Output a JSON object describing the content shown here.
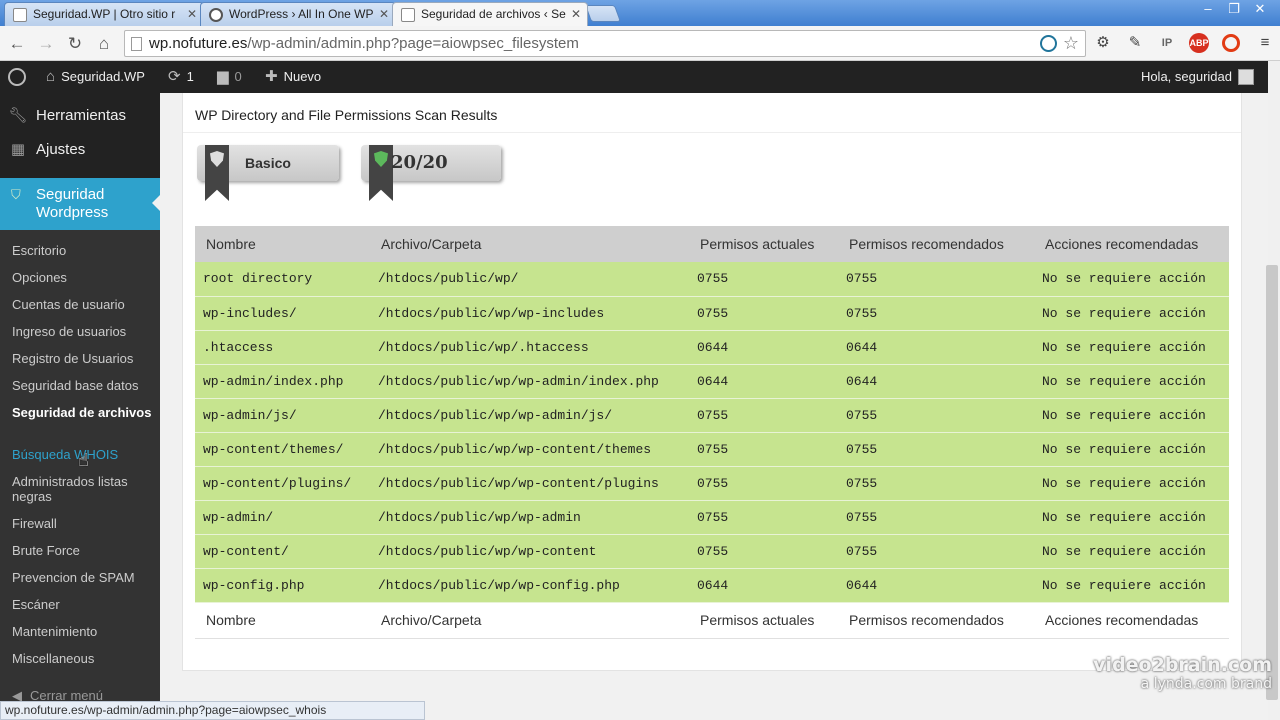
{
  "browser": {
    "tabs": [
      {
        "label": "Seguridad.WP | Otro sitio r",
        "active": false
      },
      {
        "label": "WordPress › All In One WP",
        "active": false
      },
      {
        "label": "Seguridad de archivos ‹ Se",
        "active": true
      }
    ],
    "url_host": "wp.nofuture.es",
    "url_path": "/wp-admin/admin.php?page=aiowpsec_filesystem",
    "status_url": "wp.nofuture.es/wp-admin/admin.php?page=aiowpsec_whois"
  },
  "adminbar": {
    "site_name": "Seguridad.WP",
    "updates_count": "1",
    "comments_count": "0",
    "new_label": "Nuevo",
    "greeting": "Hola, seguridad"
  },
  "sidebar": {
    "top_items": [
      {
        "label": "Herramientas",
        "icon": "wrench-icon"
      },
      {
        "label": "Ajustes",
        "icon": "settings-icon"
      }
    ],
    "active_menu": "Seguridad Wordpress",
    "submenu": [
      {
        "label": "Escritorio"
      },
      {
        "label": "Opciones"
      },
      {
        "label": "Cuentas de usuario"
      },
      {
        "label": "Ingreso de usuarios"
      },
      {
        "label": "Registro de Usuarios"
      },
      {
        "label": "Seguridad base datos"
      },
      {
        "label": "Seguridad de archivos",
        "current": true
      },
      {
        "label": "Búsqueda WHOIS",
        "hover": true
      },
      {
        "label": "Administrados listas negras"
      },
      {
        "label": "Firewall"
      },
      {
        "label": "Brute Force"
      },
      {
        "label": "Prevencion de SPAM"
      },
      {
        "label": "Escáner"
      },
      {
        "label": "Mantenimiento"
      },
      {
        "label": "Miscellaneous"
      }
    ],
    "collapse_label": "Cerrar menú"
  },
  "content": {
    "box_title": "WP Directory and File Permissions Scan Results",
    "badge_level": "Basico",
    "badge_score": "20/20",
    "columns": [
      "Nombre",
      "Archivo/Carpeta",
      "Permisos actuales",
      "Permisos recomendados",
      "Acciones recomendadas"
    ],
    "rows": [
      [
        "root directory",
        "/htdocs/public/wp/",
        "0755",
        "0755",
        "No se requiere acción"
      ],
      [
        "wp-includes/",
        "/htdocs/public/wp/wp-includes",
        "0755",
        "0755",
        "No se requiere acción"
      ],
      [
        ".htaccess",
        "/htdocs/public/wp/.htaccess",
        "0644",
        "0644",
        "No se requiere acción"
      ],
      [
        "wp-admin/index.php",
        "/htdocs/public/wp/wp-admin/index.php",
        "0644",
        "0644",
        "No se requiere acción"
      ],
      [
        "wp-admin/js/",
        "/htdocs/public/wp/wp-admin/js/",
        "0755",
        "0755",
        "No se requiere acción"
      ],
      [
        "wp-content/themes/",
        "/htdocs/public/wp/wp-content/themes",
        "0755",
        "0755",
        "No se requiere acción"
      ],
      [
        "wp-content/plugins/",
        "/htdocs/public/wp/wp-content/plugins",
        "0755",
        "0755",
        "No se requiere acción"
      ],
      [
        "wp-admin/",
        "/htdocs/public/wp/wp-admin",
        "0755",
        "0755",
        "No se requiere acción"
      ],
      [
        "wp-content/",
        "/htdocs/public/wp/wp-content",
        "0755",
        "0755",
        "No se requiere acción"
      ],
      [
        "wp-config.php",
        "/htdocs/public/wp/wp-config.php",
        "0644",
        "0644",
        "No se requiere acción"
      ]
    ]
  },
  "watermark": {
    "line1": "video2brain.com",
    "line2": "a lynda.com brand"
  },
  "colors": {
    "ok_row": "#c6e48f",
    "active_menu": "#2ea2cc",
    "admin_bg": "#222222"
  }
}
